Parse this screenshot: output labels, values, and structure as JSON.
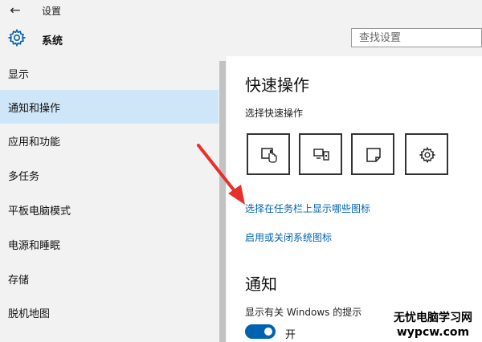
{
  "window": {
    "title": "设置",
    "back_icon": "back-arrow-icon"
  },
  "header": {
    "title": "系统",
    "icon": "gear-icon",
    "search_placeholder": "查找设置"
  },
  "sidebar": {
    "items": [
      {
        "label": "显示",
        "active": false
      },
      {
        "label": "通知和操作",
        "active": true
      },
      {
        "label": "应用和功能",
        "active": false
      },
      {
        "label": "多任务",
        "active": false
      },
      {
        "label": "平板电脑模式",
        "active": false
      },
      {
        "label": "电源和睡眠",
        "active": false
      },
      {
        "label": "存储",
        "active": false
      },
      {
        "label": "脱机地图",
        "active": false
      }
    ]
  },
  "main": {
    "quick_actions": {
      "title": "快速操作",
      "subtitle": "选择快速操作",
      "tiles": [
        {
          "icon": "tablet-mode-icon"
        },
        {
          "icon": "project-display-icon"
        },
        {
          "icon": "note-icon"
        },
        {
          "icon": "settings-gear-icon"
        }
      ]
    },
    "links": [
      "选择在任务栏上显示哪些图标",
      "启用或关闭系统图标"
    ],
    "notifications": {
      "title": "通知",
      "description": "显示有关 Windows 的提示",
      "toggle_state": "开",
      "toggle_on": true
    }
  },
  "watermark": {
    "line1": "无忧电脑学习网",
    "line2": "wypcw.com"
  },
  "colors": {
    "accent": "#0063b1",
    "selected_bg": "#cfe6f8",
    "arrow": "#e8302a",
    "chrome_bg": "#f2f2f2"
  }
}
